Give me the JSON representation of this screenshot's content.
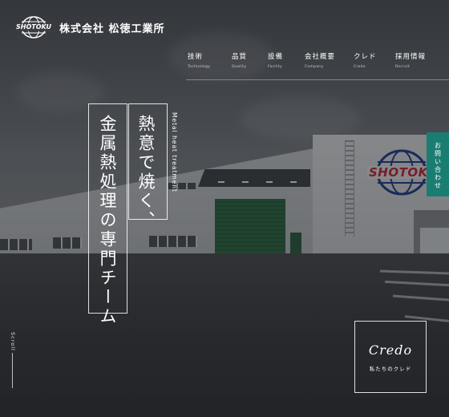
{
  "brand": {
    "logo_text": "SHOTOKU",
    "company_name": "株式会社 松徳工業所"
  },
  "nav": {
    "items": [
      {
        "ja": "技術",
        "en": "Technology"
      },
      {
        "ja": "品質",
        "en": "Quality"
      },
      {
        "ja": "設備",
        "en": "Facility"
      },
      {
        "ja": "会社概要",
        "en": "Company"
      },
      {
        "ja": "クレド",
        "en": "Credo"
      },
      {
        "ja": "採用情報",
        "en": "Recruit"
      }
    ]
  },
  "hero": {
    "copy_line_1": "熱意で焼く、",
    "copy_line_2": "金属熱処理の専門チーム",
    "copy_en": "Metal heat treatment",
    "building_sign": "SHOTOKU"
  },
  "contact": {
    "label": "お問い合わせ"
  },
  "scroll": {
    "label": "Scroll"
  },
  "credo": {
    "title": "Credo",
    "subtitle": "私たちのクレド"
  },
  "colors": {
    "accent_teal": "#1a7d72",
    "overlay": "#15181c",
    "shutter_green": "#2e6a43",
    "sign_red": "#c8253a",
    "sign_blue": "#1f3f8a"
  },
  "icons": {
    "logo": "globe-logo-icon"
  }
}
